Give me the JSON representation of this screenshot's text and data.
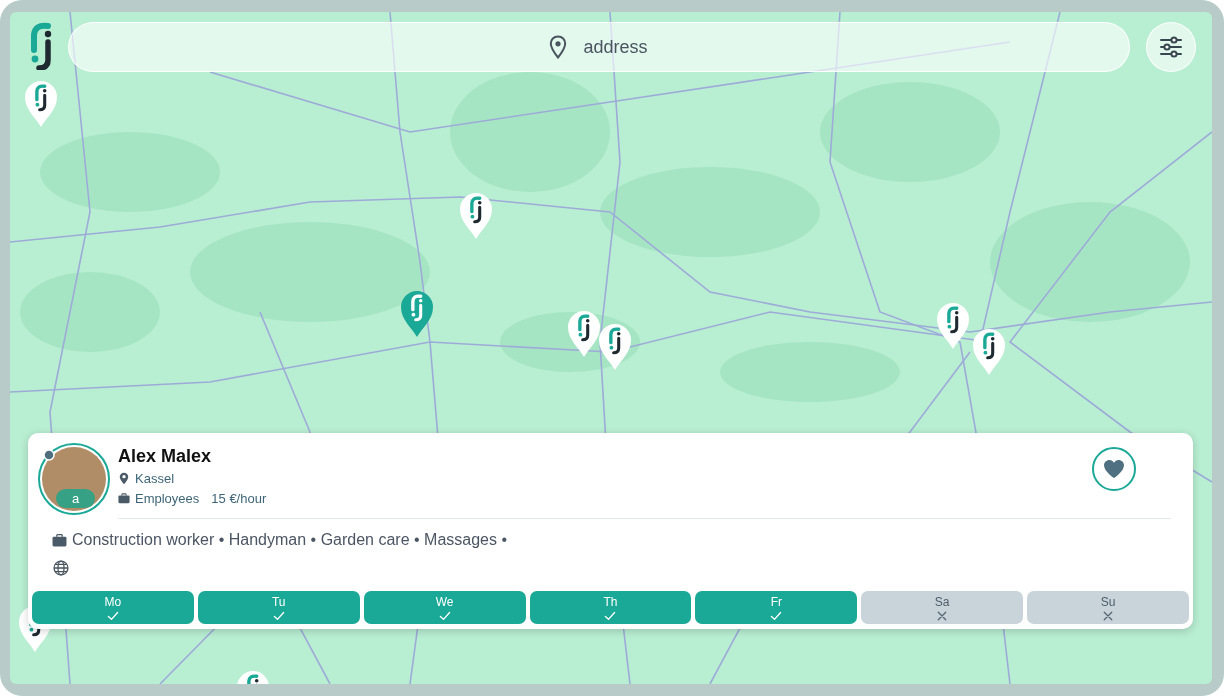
{
  "search": {
    "placeholder": "address"
  },
  "map": {
    "pins": [
      {
        "selected": false
      },
      {
        "selected": false
      },
      {
        "selected": true
      },
      {
        "selected": false
      },
      {
        "selected": false
      },
      {
        "selected": false
      },
      {
        "selected": false
      },
      {
        "selected": false
      },
      {
        "selected": false
      }
    ]
  },
  "profile": {
    "name": "Alex Malex",
    "badge": "a",
    "location": "Kassel",
    "employment": "Employees",
    "rate": "15 €/hour",
    "skills": "Construction worker • Handyman • Garden care • Massages •",
    "days": [
      {
        "label": "Mo",
        "available": true
      },
      {
        "label": "Tu",
        "available": true
      },
      {
        "label": "We",
        "available": true
      },
      {
        "label": "Th",
        "available": true
      },
      {
        "label": "Fr",
        "available": true
      },
      {
        "label": "Sa",
        "available": false
      },
      {
        "label": "Su",
        "available": false
      }
    ]
  }
}
